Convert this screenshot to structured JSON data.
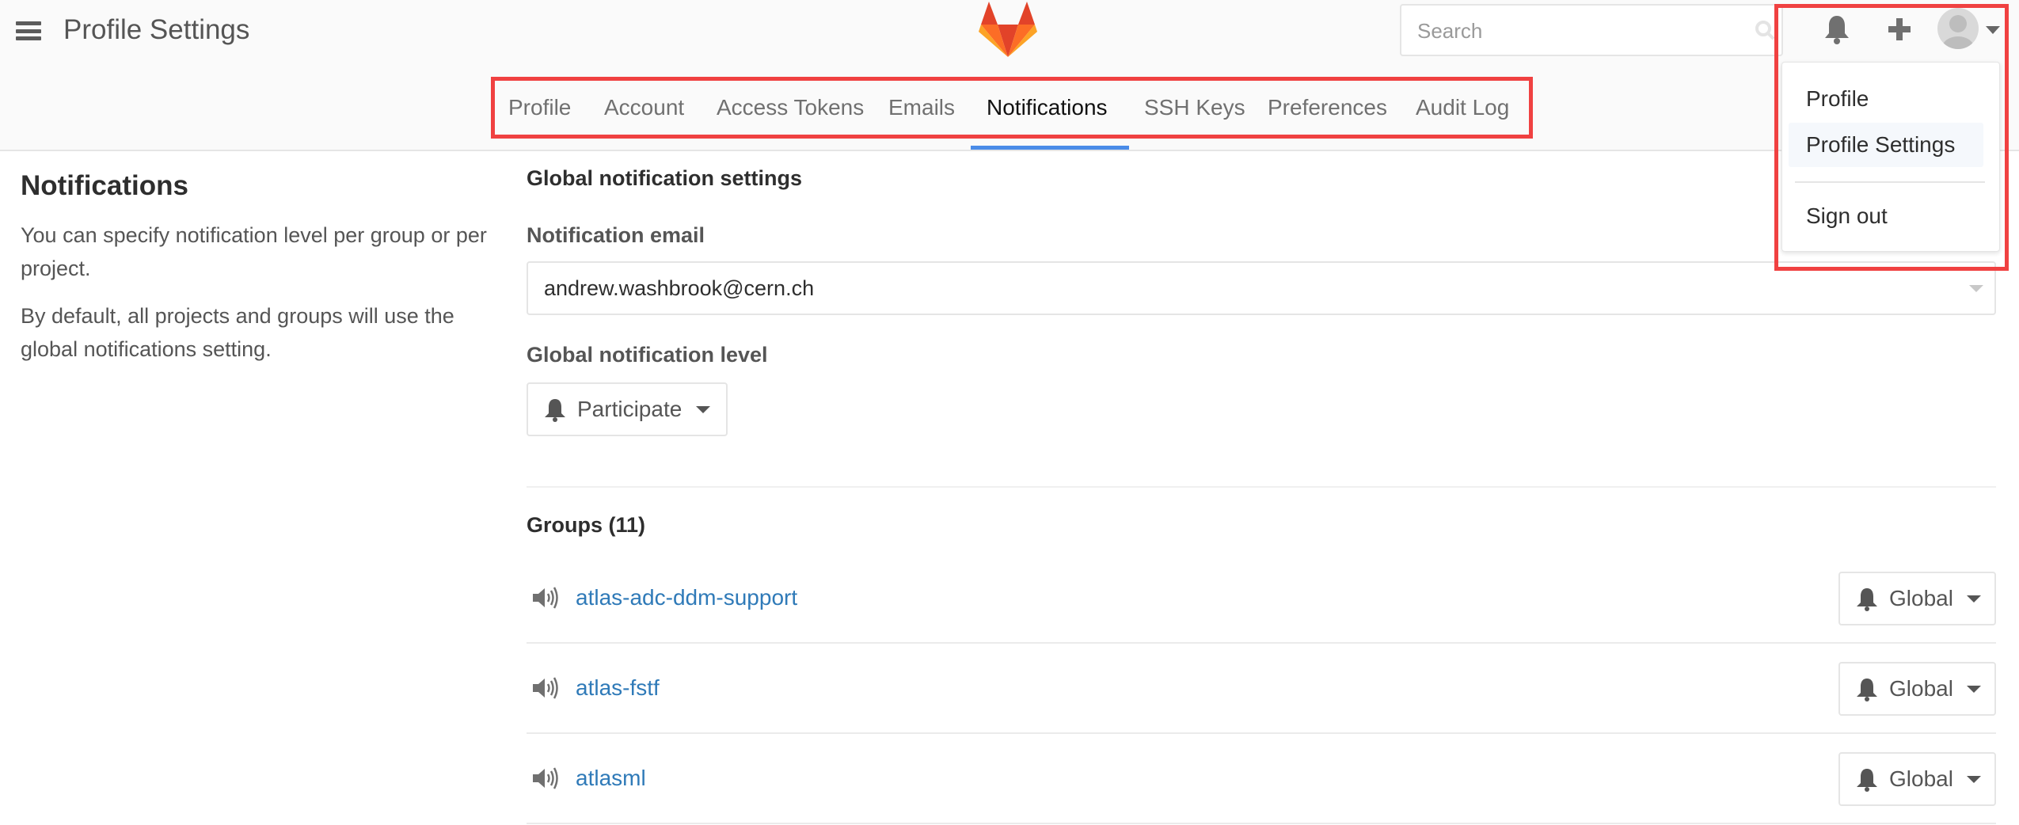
{
  "header": {
    "title": "Profile Settings",
    "search": {
      "placeholder": "Search",
      "value": ""
    },
    "icons": [
      "hamburger-icon",
      "gitlab-logo",
      "search-icon",
      "bell-icon",
      "plus-icon",
      "avatar",
      "caret-down-icon"
    ]
  },
  "user_menu": {
    "items": [
      {
        "label": "Profile",
        "active": false
      },
      {
        "label": "Profile Settings",
        "active": true
      },
      {
        "label": "Sign out",
        "active": false
      }
    ]
  },
  "tabs": [
    {
      "label": "Profile",
      "active": false
    },
    {
      "label": "Account",
      "active": false
    },
    {
      "label": "Access Tokens",
      "active": false
    },
    {
      "label": "Emails",
      "active": false
    },
    {
      "label": "Notifications",
      "active": true
    },
    {
      "label": "SSH Keys",
      "active": false
    },
    {
      "label": "Preferences",
      "active": false
    },
    {
      "label": "Audit Log",
      "active": false
    }
  ],
  "sidebar": {
    "title": "Notifications",
    "paragraphs": [
      "You can specify notification level per group or per project.",
      "By default, all projects and groups will use the global notifications setting."
    ]
  },
  "main": {
    "section_title": "Global notification settings",
    "email_label": "Notification email",
    "email_value": "andrew.washbrook@cern.ch",
    "level_label": "Global notification level",
    "level_value": "Participate",
    "groups_title": "Groups (11)",
    "groups": [
      {
        "name": "atlas-adc-ddm-support",
        "level": "Global"
      },
      {
        "name": "atlas-fstf",
        "level": "Global"
      },
      {
        "name": "atlasml",
        "level": "Global"
      }
    ]
  },
  "colors": {
    "accent": "#4a8ce8",
    "link": "#2f7ab8",
    "highlight_box": "#f04141"
  }
}
